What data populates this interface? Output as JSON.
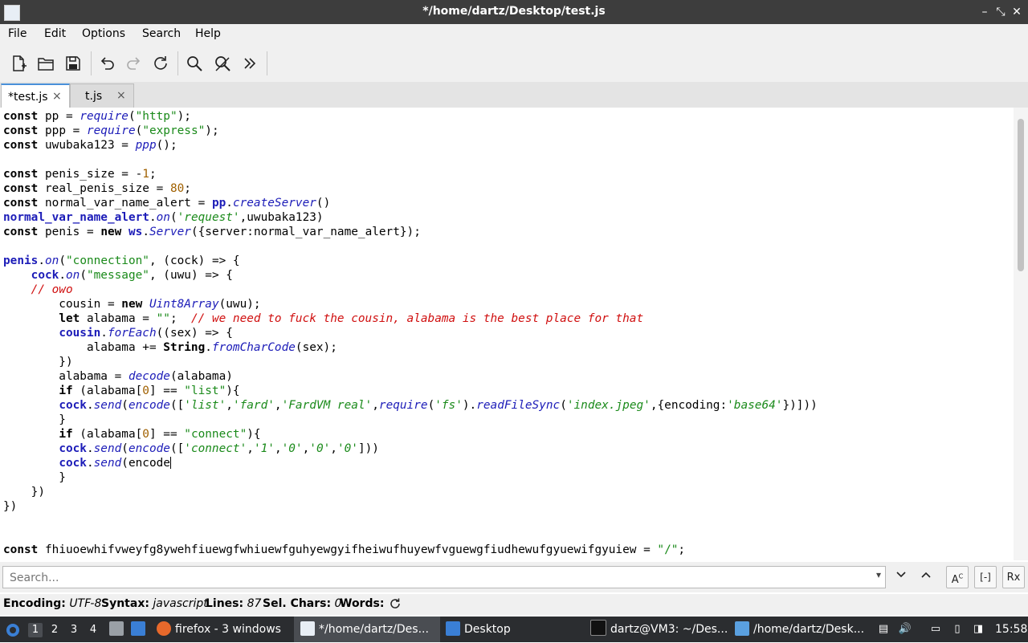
{
  "window": {
    "title": "*/home/dartz/Desktop/test.js"
  },
  "menu": {
    "file": "File",
    "edit": "Edit",
    "options": "Options",
    "search": "Search",
    "help": "Help"
  },
  "tabs": [
    {
      "label": "*test.js",
      "close": "×"
    },
    {
      "label": "t.js",
      "close": "×"
    }
  ],
  "search": {
    "placeholder": "Search...",
    "value": "",
    "regex_label": "Rx"
  },
  "status": {
    "encoding_label": "Encoding:",
    "encoding_value": "UTF-8",
    "syntax_label": "Syntax:",
    "syntax_value": "javascript",
    "lines_label": "Lines:",
    "lines_value": "87",
    "selchars_label": "Sel. Chars:",
    "selchars_value": "0",
    "words_label": "Words:"
  },
  "taskbar": {
    "workspaces": [
      "1",
      "2",
      "3",
      "4"
    ],
    "firefox": "firefox - 3 windows",
    "editor": "*/home/dartz/Des...",
    "desktop": "Desktop",
    "terminal": "dartz@VM3: ~/Des...",
    "viewer": "/home/dartz/Desk...",
    "clock": "15:58"
  },
  "colors": {
    "keyword": "#000000",
    "identifier": "#1c1cb8",
    "string": "#1a8a1a",
    "number": "#a06000",
    "comment": "#d01010",
    "tab_accent": "#4a90d9"
  },
  "icons": [
    "new-file-icon",
    "open-folder-icon",
    "save-icon",
    "undo-icon",
    "redo-icon",
    "reload-icon",
    "find-icon",
    "replace-icon",
    "more-icon",
    "chevron-down-icon",
    "chevron-up-icon",
    "match-case-icon",
    "whole-word-icon",
    "refresh-icon"
  ],
  "code": [
    [
      [
        "kw",
        "const"
      ],
      [
        "t",
        " pp = "
      ],
      [
        "fn",
        "require"
      ],
      [
        "t",
        "("
      ],
      [
        "str",
        "\"http\""
      ],
      [
        "t",
        ");"
      ]
    ],
    [
      [
        "kw",
        "const"
      ],
      [
        "t",
        " ppp = "
      ],
      [
        "fn",
        "require"
      ],
      [
        "t",
        "("
      ],
      [
        "str",
        "\"express\""
      ],
      [
        "t",
        ");"
      ]
    ],
    [
      [
        "kw",
        "const"
      ],
      [
        "t",
        " uwubaka123 = "
      ],
      [
        "fn",
        "ppp"
      ],
      [
        "t",
        "();"
      ]
    ],
    [],
    [
      [
        "kw",
        "const"
      ],
      [
        "t",
        " penis_size = -"
      ],
      [
        "num",
        "1"
      ],
      [
        "t",
        ";"
      ]
    ],
    [
      [
        "kw",
        "const"
      ],
      [
        "t",
        " real_penis_size = "
      ],
      [
        "num",
        "80"
      ],
      [
        "t",
        ";"
      ]
    ],
    [
      [
        "kw",
        "const"
      ],
      [
        "t",
        " normal_var_name_alert = "
      ],
      [
        "obj",
        "pp"
      ],
      [
        "t",
        "."
      ],
      [
        "fn",
        "createServer"
      ],
      [
        "t",
        "()"
      ]
    ],
    [
      [
        "obj",
        "normal_var_name_alert"
      ],
      [
        "t",
        "."
      ],
      [
        "fn",
        "on"
      ],
      [
        "t",
        "("
      ],
      [
        "sq",
        "'request'"
      ],
      [
        "t",
        ",uwubaka123)"
      ]
    ],
    [
      [
        "kw",
        "const"
      ],
      [
        "t",
        " penis = "
      ],
      [
        "kw",
        "new"
      ],
      [
        "t",
        " "
      ],
      [
        "obj",
        "ws"
      ],
      [
        "t",
        "."
      ],
      [
        "fn",
        "Server"
      ],
      [
        "t",
        "({server:normal_var_name_alert});"
      ]
    ],
    [],
    [
      [
        "obj",
        "penis"
      ],
      [
        "t",
        "."
      ],
      [
        "fn",
        "on"
      ],
      [
        "t",
        "("
      ],
      [
        "str",
        "\"connection\""
      ],
      [
        "t",
        ", (cock) => {"
      ]
    ],
    [
      [
        "t",
        "    "
      ],
      [
        "obj",
        "cock"
      ],
      [
        "t",
        "."
      ],
      [
        "fn",
        "on"
      ],
      [
        "t",
        "("
      ],
      [
        "str",
        "\"message\""
      ],
      [
        "t",
        ", (uwu) => {"
      ]
    ],
    [
      [
        "t",
        "    "
      ],
      [
        "cmt",
        "// owo"
      ]
    ],
    [
      [
        "t",
        "        cousin = "
      ],
      [
        "kw",
        "new"
      ],
      [
        "t",
        " "
      ],
      [
        "fn",
        "Uint8Array"
      ],
      [
        "t",
        "(uwu);"
      ]
    ],
    [
      [
        "t",
        "        "
      ],
      [
        "kw",
        "let"
      ],
      [
        "t",
        " alabama = "
      ],
      [
        "str",
        "\"\""
      ],
      [
        "t",
        ";  "
      ],
      [
        "cmt",
        "// we need to fuck the cousin, alabama is the best place for that"
      ]
    ],
    [
      [
        "t",
        "        "
      ],
      [
        "obj",
        "cousin"
      ],
      [
        "t",
        "."
      ],
      [
        "fn",
        "forEach"
      ],
      [
        "t",
        "((sex) => {"
      ]
    ],
    [
      [
        "t",
        "            alabama += "
      ],
      [
        "kw",
        "String"
      ],
      [
        "t",
        "."
      ],
      [
        "fn",
        "fromCharCode"
      ],
      [
        "t",
        "(sex);"
      ]
    ],
    [
      [
        "t",
        "        })"
      ]
    ],
    [
      [
        "t",
        "        alabama = "
      ],
      [
        "fn",
        "decode"
      ],
      [
        "t",
        "(alabama)"
      ]
    ],
    [
      [
        "t",
        "        "
      ],
      [
        "kw",
        "if"
      ],
      [
        "t",
        " (alabama["
      ],
      [
        "num",
        "0"
      ],
      [
        "t",
        "] == "
      ],
      [
        "str",
        "\"list\""
      ],
      [
        "t",
        "){"
      ]
    ],
    [
      [
        "t",
        "        "
      ],
      [
        "obj",
        "cock"
      ],
      [
        "t",
        "."
      ],
      [
        "fn",
        "send"
      ],
      [
        "t",
        "("
      ],
      [
        "fn",
        "encode"
      ],
      [
        "t",
        "(["
      ],
      [
        "sq",
        "'list'"
      ],
      [
        "t",
        ","
      ],
      [
        "sq",
        "'fard'"
      ],
      [
        "t",
        ","
      ],
      [
        "sq",
        "'FardVM real'"
      ],
      [
        "t",
        ","
      ],
      [
        "fn",
        "require"
      ],
      [
        "t",
        "("
      ],
      [
        "sq",
        "'fs'"
      ],
      [
        "t",
        ")."
      ],
      [
        "fn",
        "readFileSync"
      ],
      [
        "t",
        "("
      ],
      [
        "sq",
        "'index.jpeg'"
      ],
      [
        "t",
        ",{encoding:"
      ],
      [
        "sq",
        "'base64'"
      ],
      [
        "t",
        "})]))"
      ]
    ],
    [
      [
        "t",
        "        }"
      ]
    ],
    [
      [
        "t",
        "        "
      ],
      [
        "kw",
        "if"
      ],
      [
        "t",
        " (alabama["
      ],
      [
        "num",
        "0"
      ],
      [
        "t",
        "] == "
      ],
      [
        "str",
        "\"connect\""
      ],
      [
        "t",
        "){"
      ]
    ],
    [
      [
        "t",
        "        "
      ],
      [
        "obj",
        "cock"
      ],
      [
        "t",
        "."
      ],
      [
        "fn",
        "send"
      ],
      [
        "t",
        "("
      ],
      [
        "fn",
        "encode"
      ],
      [
        "t",
        "(["
      ],
      [
        "sq",
        "'connect'"
      ],
      [
        "t",
        ","
      ],
      [
        "sq",
        "'1'"
      ],
      [
        "t",
        ","
      ],
      [
        "sq",
        "'0'"
      ],
      [
        "t",
        ","
      ],
      [
        "sq",
        "'0'"
      ],
      [
        "t",
        ","
      ],
      [
        "sq",
        "'0'"
      ],
      [
        "t",
        "]))"
      ]
    ],
    [
      [
        "t",
        "        "
      ],
      [
        "obj",
        "cock"
      ],
      [
        "t",
        "."
      ],
      [
        "fn",
        "send"
      ],
      [
        "t",
        "(encode"
      ],
      [
        "caret",
        ""
      ]
    ],
    [
      [
        "t",
        "        }"
      ]
    ],
    [
      [
        "t",
        "    })"
      ]
    ],
    [
      [
        "t",
        "})"
      ]
    ],
    [],
    [],
    [
      [
        "kw",
        "const"
      ],
      [
        "t",
        " fhiuoewhifvweyfg8ywehfiuewgfwhiuewfguhyewgyifheiwufhuyewfvguewgfiudhewufgyuewifgyuiew = "
      ],
      [
        "str",
        "\"/\""
      ],
      [
        "t",
        ";"
      ]
    ]
  ]
}
